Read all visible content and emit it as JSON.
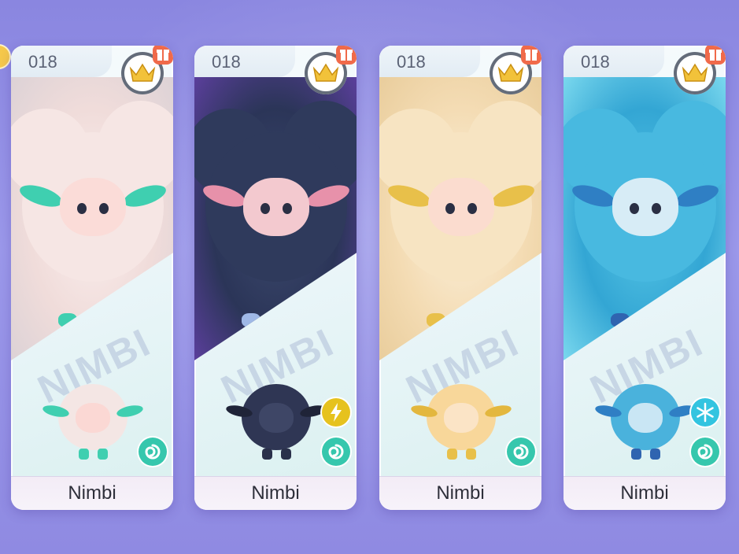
{
  "colors": {
    "background": "#8f8be3",
    "crown": "#f2c23a",
    "gift": "#f06a4a",
    "spiral_badge": "#36c7ad",
    "electric_badge": "#e6c21e",
    "ice_badge": "#33c4e0"
  },
  "cards": [
    {
      "number": "018",
      "brand": "NIMBI",
      "name": "Nimbi",
      "variant_color": "#3fcfb0",
      "icons": [
        "crown-icon",
        "gift-icon",
        "spiral-icon"
      ]
    },
    {
      "number": "018",
      "brand": "NIMBI",
      "name": "Nimbi",
      "variant_color": "#2f3a5c",
      "type_icon": "lightning-icon",
      "icons": [
        "crown-icon",
        "gift-icon",
        "lightning-icon",
        "spiral-icon"
      ]
    },
    {
      "number": "018",
      "brand": "NIMBI",
      "name": "Nimbi",
      "variant_color": "#e8c04a",
      "icons": [
        "crown-icon",
        "gift-icon",
        "spiral-icon"
      ]
    },
    {
      "number": "018",
      "brand": "NIMBI",
      "name": "Nimbi",
      "variant_color": "#48b9e0",
      "type_icon": "snowflake-icon",
      "icons": [
        "crown-icon",
        "gift-icon",
        "snowflake-icon",
        "spiral-icon"
      ]
    }
  ]
}
